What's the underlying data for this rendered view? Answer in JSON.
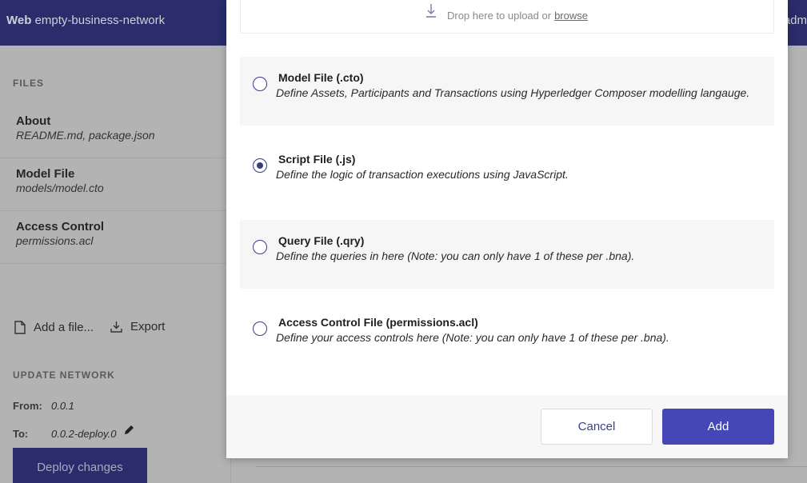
{
  "header": {
    "brand_bold": "Web",
    "brand_name": "empty-business-network",
    "right_text": "adm"
  },
  "sidebar": {
    "files_heading": "FILES",
    "files": [
      {
        "title": "About",
        "subtitle": "README.md, package.json"
      },
      {
        "title": "Model File",
        "subtitle": "models/model.cto"
      },
      {
        "title": "Access Control",
        "subtitle": "permissions.acl"
      }
    ],
    "add_file_label": "Add a file...",
    "export_label": "Export",
    "update_heading": "UPDATE NETWORK",
    "from_label": "From:",
    "from_value": "0.0.1",
    "to_label": "To:",
    "to_value": "0.0.2-deploy.0",
    "deploy_label": "Deploy changes"
  },
  "modal": {
    "dropzone_text": "Drop here to upload or",
    "dropzone_link": "browse",
    "options": [
      {
        "title": "Model File (.cto)",
        "description": "Define Assets, Participants and Transactions using Hyperledger Composer modelling langauge.",
        "checked": false
      },
      {
        "title": "Script File (.js)",
        "description": "Define the logic of transaction executions using JavaScript.",
        "checked": true
      },
      {
        "title": "Query File (.qry)",
        "description": "Define the queries in here (Note: you can only have 1 of these per .bna).",
        "checked": false
      },
      {
        "title": "Access Control File (permissions.acl)",
        "description": "Define your access controls here (Note: you can only have 1 of these per .bna).",
        "checked": false
      }
    ],
    "cancel_label": "Cancel",
    "add_label": "Add"
  },
  "colors": {
    "primary": "#4547b7",
    "header_bg": "#2a2c6b",
    "radio": "#3a3c8c"
  },
  "icons": [
    "upload-icon",
    "add-file-icon",
    "export-icon",
    "pencil-icon"
  ]
}
